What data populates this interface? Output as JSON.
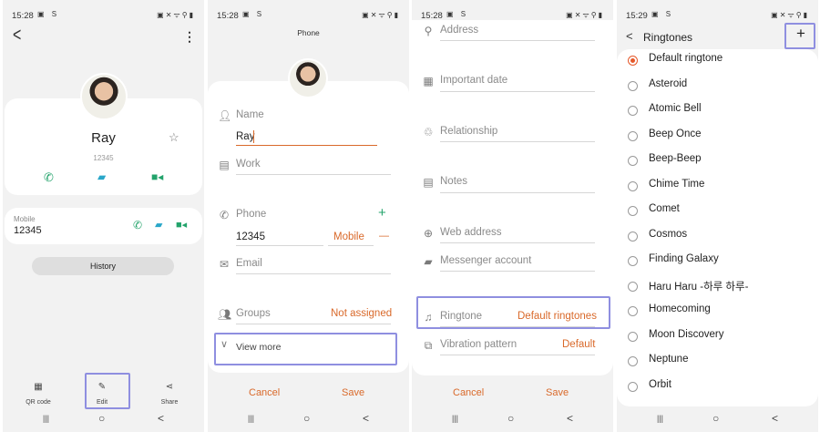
{
  "status_bar": {
    "panels": [
      {
        "time": "15:28",
        "left_icons": "▣ S",
        "right_icons": "▣✕ᯤ⚲▮"
      },
      {
        "time": "15:28",
        "left_icons": "▣ S",
        "right_icons": "▣✕ᯤ⚲▮"
      },
      {
        "time": "15:28",
        "left_icons": "▣ S",
        "right_icons": "▣✕ᯤ⚲▮"
      },
      {
        "time": "15:29",
        "left_icons": "▣ S",
        "right_icons": "▣✕ᯤ⚲▮"
      }
    ]
  },
  "nav_glyphs": {
    "recents": "|||",
    "home": "○",
    "back": "<"
  },
  "contact_view": {
    "back_glyph": "<",
    "menu_glyph": "⋮",
    "name": "Ray",
    "number": "12345",
    "star_glyph": "☆",
    "phone_label": "Mobile",
    "phone_value": "12345",
    "history_label": "History",
    "bottom": {
      "qr_label": "QR code",
      "edit_label": "Edit",
      "share_label": "Share"
    }
  },
  "edit_contact": {
    "header": "Phone",
    "name_label": "Name",
    "name_value": "Ray",
    "work_label": "Work",
    "phone_label": "Phone",
    "phone_value": "12345",
    "phone_type": "Mobile",
    "add_glyph": "+",
    "remove_glyph": "—",
    "email_label": "Email",
    "groups_label": "Groups",
    "groups_value": "Not assigned",
    "view_more_label": "View more",
    "cancel_label": "Cancel",
    "save_label": "Save"
  },
  "edit_more": {
    "address_label": "Address",
    "important_date_label": "Important date",
    "relationship_label": "Relationship",
    "notes_label": "Notes",
    "web_label": "Web address",
    "messenger_label": "Messenger account",
    "ringtone_label": "Ringtone",
    "ringtone_value": "Default ringtones",
    "vibration_label": "Vibration pattern",
    "vibration_value": "Default",
    "cancel_label": "Cancel",
    "save_label": "Save"
  },
  "ringtones": {
    "back_glyph": "<",
    "title": "Ringtones",
    "add_glyph": "+",
    "selected_index": 0,
    "items": [
      "Default ringtone",
      "Asteroid",
      "Atomic Bell",
      "Beep Once",
      "Beep-Beep",
      "Chime Time",
      "Comet",
      "Cosmos",
      "Finding Galaxy",
      "Haru Haru -하루 하루-",
      "Homecoming",
      "Moon Discovery",
      "Neptune",
      "Orbit"
    ]
  },
  "colors": {
    "accent": "#d9692a",
    "green": "#23a36b",
    "teal": "#2aa7c9",
    "highlight": "#8f8fe0"
  }
}
